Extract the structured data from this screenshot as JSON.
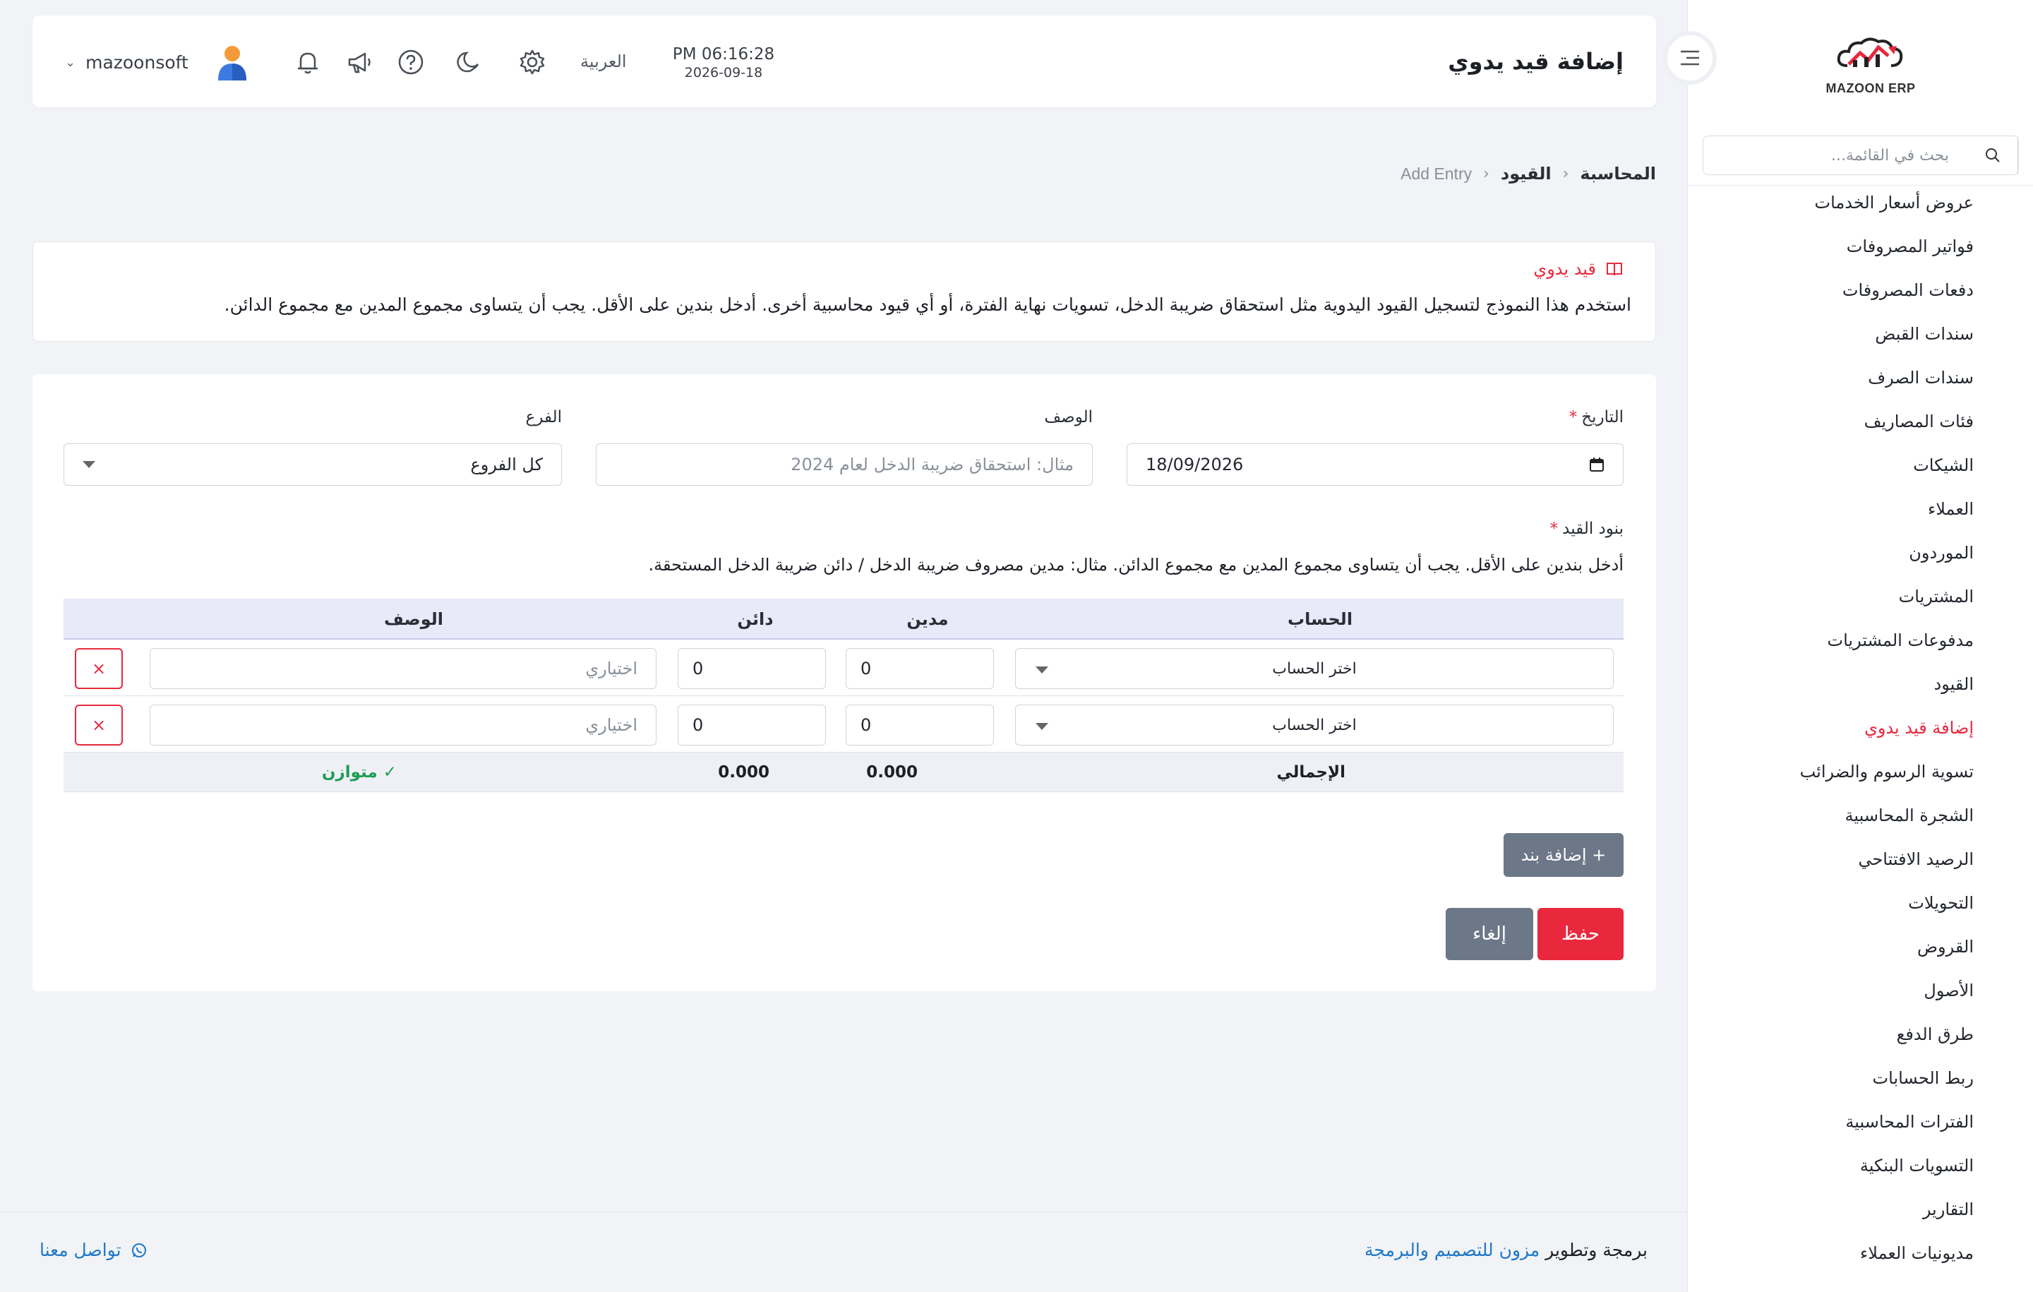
{
  "app": {
    "logo_text": "MAZOON ERP",
    "accent_color": "#e8283d",
    "link_color": "#1e78c8"
  },
  "sidebar": {
    "search_placeholder": "بحث في القائمة...",
    "items": [
      {
        "label": "عروض أسعار الخدمات",
        "active": false
      },
      {
        "label": "فواتير المصروفات",
        "active": false
      },
      {
        "label": "دفعات المصروفات",
        "active": false
      },
      {
        "label": "سندات القبض",
        "active": false
      },
      {
        "label": "سندات الصرف",
        "active": false
      },
      {
        "label": "فئات المصاريف",
        "active": false
      },
      {
        "label": "الشيكات",
        "active": false
      },
      {
        "label": "العملاء",
        "active": false
      },
      {
        "label": "الموردون",
        "active": false
      },
      {
        "label": "المشتريات",
        "active": false
      },
      {
        "label": "مدفوعات المشتريات",
        "active": false
      },
      {
        "label": "القيود",
        "active": false
      },
      {
        "label": "إضافة قيد يدوي",
        "active": true
      },
      {
        "label": "تسوية الرسوم والضرائب",
        "active": false
      },
      {
        "label": "الشجرة المحاسبية",
        "active": false
      },
      {
        "label": "الرصيد الافتتاحي",
        "active": false
      },
      {
        "label": "التحويلات",
        "active": false
      },
      {
        "label": "القروض",
        "active": false
      },
      {
        "label": "الأصول",
        "active": false
      },
      {
        "label": "طرق الدفع",
        "active": false
      },
      {
        "label": "ربط الحسابات",
        "active": false
      },
      {
        "label": "الفترات المحاسبية",
        "active": false
      },
      {
        "label": "التسويات البنكية",
        "active": false
      },
      {
        "label": "التقارير",
        "active": false
      },
      {
        "label": "مديونيات العملاء",
        "active": false
      }
    ]
  },
  "header": {
    "title": "إضافة قيد يدوي",
    "time": "PM 06:16:28",
    "date": "2026-09-18",
    "language": "العربية",
    "username": "mazoonsoft",
    "icons": [
      "settings-icon",
      "moon-icon",
      "help-icon",
      "megaphone-icon",
      "bell-icon"
    ]
  },
  "breadcrumb": {
    "items": [
      "المحاسبة",
      "القيود",
      "Add Entry"
    ]
  },
  "info": {
    "title": "قيد يدوي",
    "text": "استخدم هذا النموذج لتسجيل القيود اليدوية مثل استحقاق ضريبة الدخل، تسويات نهاية الفترة، أو أي قيود محاسبية أخرى. أدخل بندين على الأقل. يجب أن يتساوى مجموع المدين مع مجموع الدائن."
  },
  "form": {
    "date_label": "التاريخ",
    "date_value": "18/09/2026",
    "description_label": "الوصف",
    "description_placeholder": "مثال: استحقاق ضريبة الدخل لعام 2024",
    "branch_label": "الفرع",
    "branch_value": "كل الفروع",
    "lines_label": "بنود القيد",
    "lines_hint": "أدخل بندين على الأقل. يجب أن يتساوى مجموع المدين مع مجموع الدائن. مثال: مدين مصروف ضريبة الدخل / دائن ضريبة الدخل المستحقة.",
    "columns": {
      "account": "الحساب",
      "debit": "مدين",
      "credit": "دائن",
      "description": "الوصف"
    },
    "lines": [
      {
        "account": "اختر الحساب",
        "debit": "0",
        "credit": "0",
        "description_placeholder": "اختياري",
        "delete": "×"
      },
      {
        "account": "اختر الحساب",
        "debit": "0",
        "credit": "0",
        "description_placeholder": "اختياري",
        "delete": "×"
      }
    ],
    "totals": {
      "label": "الإجمالي",
      "debit": "0.000",
      "credit": "0.000",
      "status": "✓ متوازن"
    },
    "add_line_label": "+ إضافة بند",
    "save_label": "حفظ",
    "cancel_label": "إلغاء"
  },
  "footer": {
    "credit_prefix": "برمجة وتطوير",
    "credit_link": "مزون للتصميم والبرمجة",
    "contact": "تواصل معنا"
  }
}
